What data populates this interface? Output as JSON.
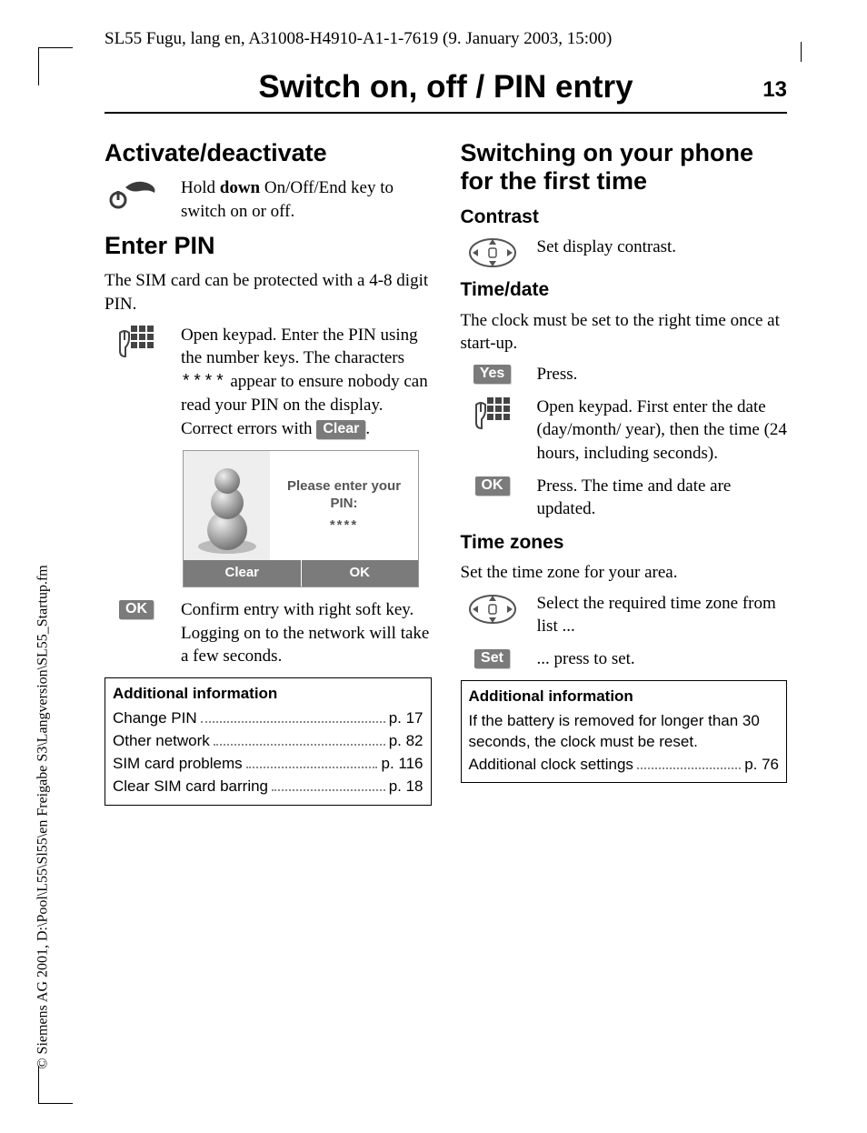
{
  "header": "SL55 Fugu, lang en, A31008-H4910-A1-1-7619 (9. January 2003, 15:00)",
  "page_title": "Switch on, off / PIN entry",
  "page_number": "13",
  "side_copyright": "© Siemens AG 2001, D:\\Pool\\L55\\Sl55\\en Freigabe S3\\Langversion\\SL55_Startup.fm",
  "left": {
    "h_activate": "Activate/deactivate",
    "activate_text_pre": "Hold ",
    "activate_bold": "down",
    "activate_text_post": " On/Off/End key to switch on or off.",
    "h_enter_pin": "Enter PIN",
    "enter_pin_intro": "The SIM card can be protected with a 4-8 digit PIN.",
    "keypad_text_pre": "Open keypad. Enter the PIN using the number keys. The characters ",
    "keypad_stars": "****",
    "keypad_text_mid": " appear to ensure nobody can read your PIN on the display. Correct errors with ",
    "keypad_clear_btn": "Clear",
    "keypad_text_post": ".",
    "screen_line1": "Please enter your",
    "screen_line2": "PIN:",
    "screen_stars": "****",
    "screen_sk_left": "Clear",
    "screen_sk_right": "OK",
    "ok_btn": "OK",
    "ok_text": "Confirm entry with right soft key. Logging on to the network will take a few seconds.",
    "info_heading": "Additional information",
    "info_items": [
      {
        "label": "Change PIN",
        "page": "p. 17"
      },
      {
        "label": "Other network",
        "page": "p. 82"
      },
      {
        "label": "SIM card problems",
        "page": "p. 116"
      },
      {
        "label": "Clear SIM card barring",
        "page": "p. 18"
      }
    ]
  },
  "right": {
    "h_first_time": "Switching on your phone for the first time",
    "h_contrast": "Contrast",
    "contrast_text": "Set display contrast.",
    "h_timedate": "Time/date",
    "timedate_intro": "The clock must be set to the right time once at start-up.",
    "yes_btn": "Yes",
    "yes_text": "Press.",
    "keypad_text": "Open keypad. First enter the date (day/month/ year), then the time (24 hours, including seconds).",
    "ok_btn": "OK",
    "ok_text": "Press. The time and date are updated.",
    "h_timezones": "Time zones",
    "tz_intro": "Set the time zone for your area.",
    "nav_text": "Select the required time zone from list ...",
    "set_btn": "Set",
    "set_text": "... press to set.",
    "info_heading": "Additional information",
    "info_body": "If the battery is removed for longer than 30 seconds, the clock must be reset.",
    "info_items": [
      {
        "label": "Additional clock settings",
        "page": "p. 76"
      }
    ]
  }
}
